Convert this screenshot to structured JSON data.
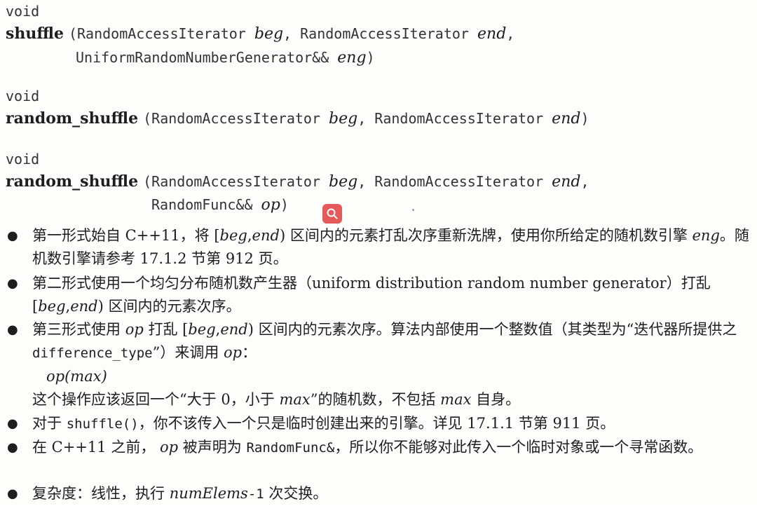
{
  "signatures": [
    {
      "ret": "void",
      "name": "shuffle",
      "line1_open": "(RandomAccessIterator ",
      "line1_beg": "beg",
      "line1_mid": ", RandomAccessIterator ",
      "line1_end": "end",
      "line1_close": ",",
      "line2_type": "UniformRandomNumberGenerator&& ",
      "line2_arg": "eng",
      "line2_close": ")"
    },
    {
      "ret": "void",
      "name": "random_shuffle",
      "line1_open": "(RandomAccessIterator ",
      "line1_beg": "beg",
      "line1_mid": ", RandomAccessIterator ",
      "line1_end": "end",
      "line1_close": ")"
    },
    {
      "ret": "void",
      "name": "random_shuffle",
      "line1_open": "(RandomAccessIterator ",
      "line1_beg": "beg",
      "line1_mid": ", RandomAccessIterator ",
      "line1_end": "end",
      "line1_close": ",",
      "line2_type": "RandomFunc&& ",
      "line2_arg": "op",
      "line2_close": ")"
    }
  ],
  "bullets": {
    "b1": {
      "t1": "第一形式始自 C++11，将 [",
      "beg": "beg",
      "comma": ",",
      "end": "end",
      "t2": ") 区间内的元素打乱次序重新洗牌，使用你所给定的随机数引擎 ",
      "eng": "eng",
      "t3": "。随机数引擎请参考 17.1.2 节第 912 页。"
    },
    "b2": {
      "t1": "第二形式使用一个均匀分布随机数产生器（uniform distribution random number generator）打乱 [",
      "beg": "beg",
      "comma": ",",
      "end": "end",
      "t2": ") 区间内的元素次序。"
    },
    "b3": {
      "t1": "第三形式使用 ",
      "op": "op",
      "t2": " 打乱 [",
      "beg": "beg",
      "comma": ",",
      "end": "end",
      "t3": ") 区间内的元素次序。算法内部使用一个整数值（其类型为“迭代器所提供之 ",
      "code": "difference_type",
      "t4": "”）来调用 ",
      "op2": "op",
      "t5": "：",
      "call_op": "op",
      "call_arg": "(max)",
      "t6": "这个操作应该返回一个“大于 0，小于 ",
      "max": "max",
      "t7": "”的随机数，不包括 ",
      "max2": "max",
      "t8": " 自身。"
    },
    "b4": {
      "t1": "对于 ",
      "code": "shuffle()",
      "t2": "，你不该传入一个只是临时创建出来的引擎。详见 17.1.1 节第 911 页。"
    },
    "b5": {
      "t1": "在 C++11 之前， ",
      "op": "op",
      "t2": " 被声明为 ",
      "code": "RandomFunc&",
      "t3": "，所以你不能够对此传入一个临时对象或一个寻常函数。"
    },
    "b6": {
      "t1": "复杂度：线性，执行 ",
      "num": "numElems",
      "code": "-1",
      "t2": " 次交换。"
    }
  },
  "overlay": {
    "search_icon": "search-icon",
    "badge_color": "#e6595a"
  }
}
